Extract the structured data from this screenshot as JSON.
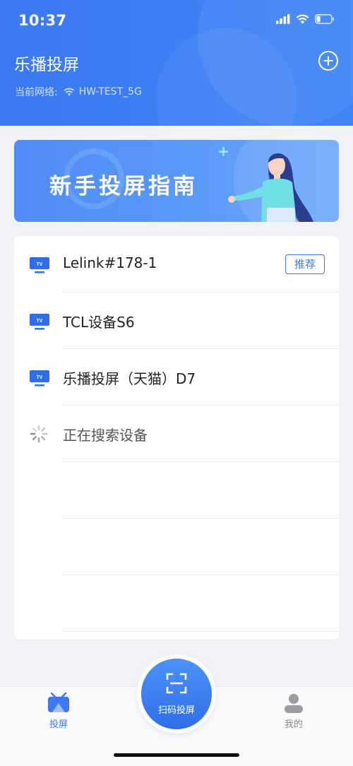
{
  "status_bar": {
    "time": "10:37"
  },
  "header": {
    "title": "乐播投屏",
    "network_label": "当前网络:",
    "network_name": "HW-TEST_5G"
  },
  "banner": {
    "title": "新手投屏指南"
  },
  "devices": [
    {
      "name": "Lelink#178-1",
      "badge": "推荐"
    },
    {
      "name": "TCL设备S6"
    },
    {
      "name": "乐播投屏（天猫）D7"
    }
  ],
  "searching_label": "正在搜索设备",
  "tabbar": {
    "cast_label": "投屏",
    "scan_label": "扫码投屏",
    "mine_label": "我的"
  },
  "colors": {
    "primary": "#3b78f2",
    "background": "#f2f3f7"
  }
}
